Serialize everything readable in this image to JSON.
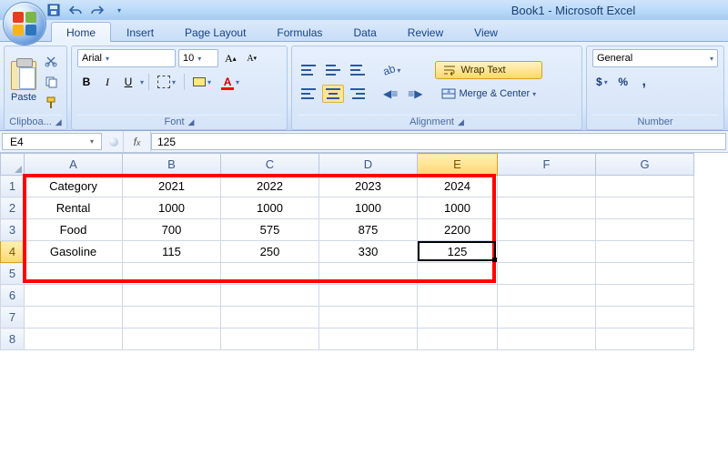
{
  "window": {
    "title": "Book1 - Microsoft Excel"
  },
  "tabs": {
    "items": [
      "Home",
      "Insert",
      "Page Layout",
      "Formulas",
      "Data",
      "Review",
      "View"
    ],
    "active": 0
  },
  "ribbon": {
    "clipboard": {
      "paste": "Paste",
      "label": "Clipboa..."
    },
    "font": {
      "family": "Arial",
      "size": "10",
      "bold": "B",
      "italic": "I",
      "underline": "U",
      "label": "Font"
    },
    "alignment": {
      "wrap": "Wrap Text",
      "merge": "Merge & Center",
      "label": "Alignment"
    },
    "number": {
      "format": "General",
      "label": "Number",
      "currency": "$",
      "percent": "%",
      "comma": ","
    }
  },
  "namebox": "E4",
  "formula": "125",
  "grid": {
    "cols": [
      "A",
      "B",
      "C",
      "D",
      "E",
      "F",
      "G"
    ],
    "selectedCol": 4,
    "selectedRow": 3,
    "rows": [
      [
        "Category",
        "2021",
        "2022",
        "2023",
        "2024",
        "",
        ""
      ],
      [
        "Rental",
        "1000",
        "1000",
        "1000",
        "1000",
        "",
        ""
      ],
      [
        "Food",
        "700",
        "575",
        "875",
        "2200",
        "",
        ""
      ],
      [
        "Gasoline",
        "115",
        "250",
        "330",
        "125",
        "",
        ""
      ],
      [
        "",
        "",
        "",
        "",
        "",
        "",
        ""
      ],
      [
        "",
        "",
        "",
        "",
        "",
        "",
        ""
      ],
      [
        "",
        "",
        "",
        "",
        "",
        "",
        ""
      ],
      [
        "",
        "",
        "",
        "",
        "",
        "",
        ""
      ]
    ]
  },
  "chart_data": {
    "type": "table",
    "title": "",
    "columns": [
      "Category",
      "2021",
      "2022",
      "2023",
      "2024"
    ],
    "rows": [
      {
        "Category": "Rental",
        "2021": 1000,
        "2022": 1000,
        "2023": 1000,
        "2024": 1000
      },
      {
        "Category": "Food",
        "2021": 700,
        "2022": 575,
        "2023": 875,
        "2024": 2200
      },
      {
        "Category": "Gasoline",
        "2021": 115,
        "2022": 250,
        "2023": 330,
        "2024": 125
      }
    ]
  }
}
